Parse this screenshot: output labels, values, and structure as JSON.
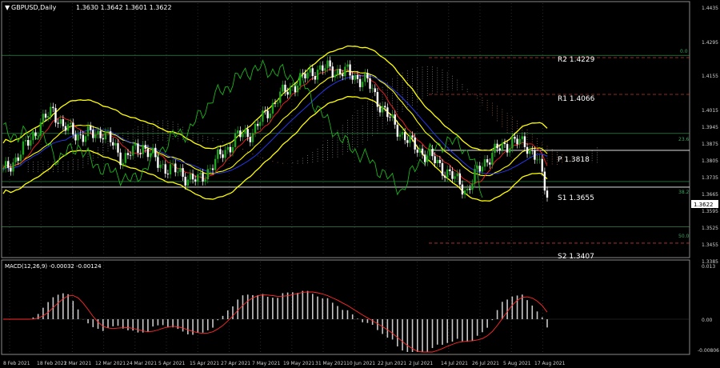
{
  "window": {
    "title": "GBPUSD,Daily",
    "ohlc": "1.3630 1.3642 1.3601 1.3622"
  },
  "colors": {
    "background": "#000000",
    "grid": "#2a2a2a",
    "axis": "#8a8a8a",
    "bull_candle": "#1ea51e",
    "bear_candle": "#ffffff",
    "bollinger": "#ffff00",
    "ma_fast": "#ff2020",
    "ma_slow": "#2a3cff",
    "chikou": "#1db11d",
    "resistance_line": "#c0392b",
    "pivot_line": "#ffffff",
    "fib_line": "#3aa35a",
    "macd_hist": "#c8c8c8",
    "macd_signal": "#ff2a2a"
  },
  "levels": [
    {
      "label": "R2",
      "value": "1.4229"
    },
    {
      "label": "R1",
      "value": "1.4066"
    },
    {
      "label": "P",
      "value": "1.3818"
    },
    {
      "label": "S1",
      "value": "1.3655"
    },
    {
      "label": "S2",
      "value": "1.3407"
    }
  ],
  "fib_labels": [
    "0.0",
    "23.6",
    "38.2",
    "50.0"
  ],
  "price_axis": [
    "1.4435",
    "1.4295",
    "1.4155",
    "1.4015",
    "1.3945",
    "1.3875",
    "1.3805",
    "1.3735",
    "1.3665",
    "1.3595",
    "1.3525",
    "1.3455",
    "1.3385"
  ],
  "current_price": "1.3622",
  "macd": {
    "label": "MACD(12,26,9) -0.00032 -0.00124",
    "axis": [
      "0.013",
      "0.00",
      "-0.00806"
    ]
  },
  "time_axis": [
    "8 Feb 2021",
    "18 Feb 2021",
    "2 Mar 2021",
    "12 Mar 2021",
    "24 Mar 2021",
    "5 Apr 2021",
    "15 Apr 2021",
    "27 Apr 2021",
    "7 May 2021",
    "19 May 2021",
    "31 May 2021",
    "10 Jun 2021",
    "22 Jun 2021",
    "2 Jul 2021",
    "14 Jul 2021",
    "26 Jul 2021",
    "5 Aug 2021",
    "17 Aug 2021"
  ],
  "chart_data": {
    "type": "line",
    "title": "GBPUSD,Daily",
    "series": [
      {
        "name": "GBPUSD",
        "x": [
          "8 Feb 2021",
          "18 Feb 2021",
          "2 Mar 2021",
          "12 Mar 2021",
          "24 Mar 2021",
          "5 Apr 2021",
          "15 Apr 2021",
          "27 Apr 2021",
          "7 May 2021",
          "19 May 2021",
          "31 May 2021",
          "10 Jun 2021",
          "22 Jun 2021",
          "2 Jul 2021",
          "14 Jul 2021",
          "26 Jul 2021",
          "5 Aug 2021",
          "17 Aug 2021"
        ],
        "values": [
          1.376,
          1.4,
          1.388,
          1.391,
          1.376,
          1.373,
          1.382,
          1.39,
          1.404,
          1.415,
          1.416,
          1.41,
          1.393,
          1.38,
          1.372,
          1.384,
          1.386,
          1.3622
        ]
      }
    ],
    "ylim": [
      1.335,
      1.447
    ]
  }
}
